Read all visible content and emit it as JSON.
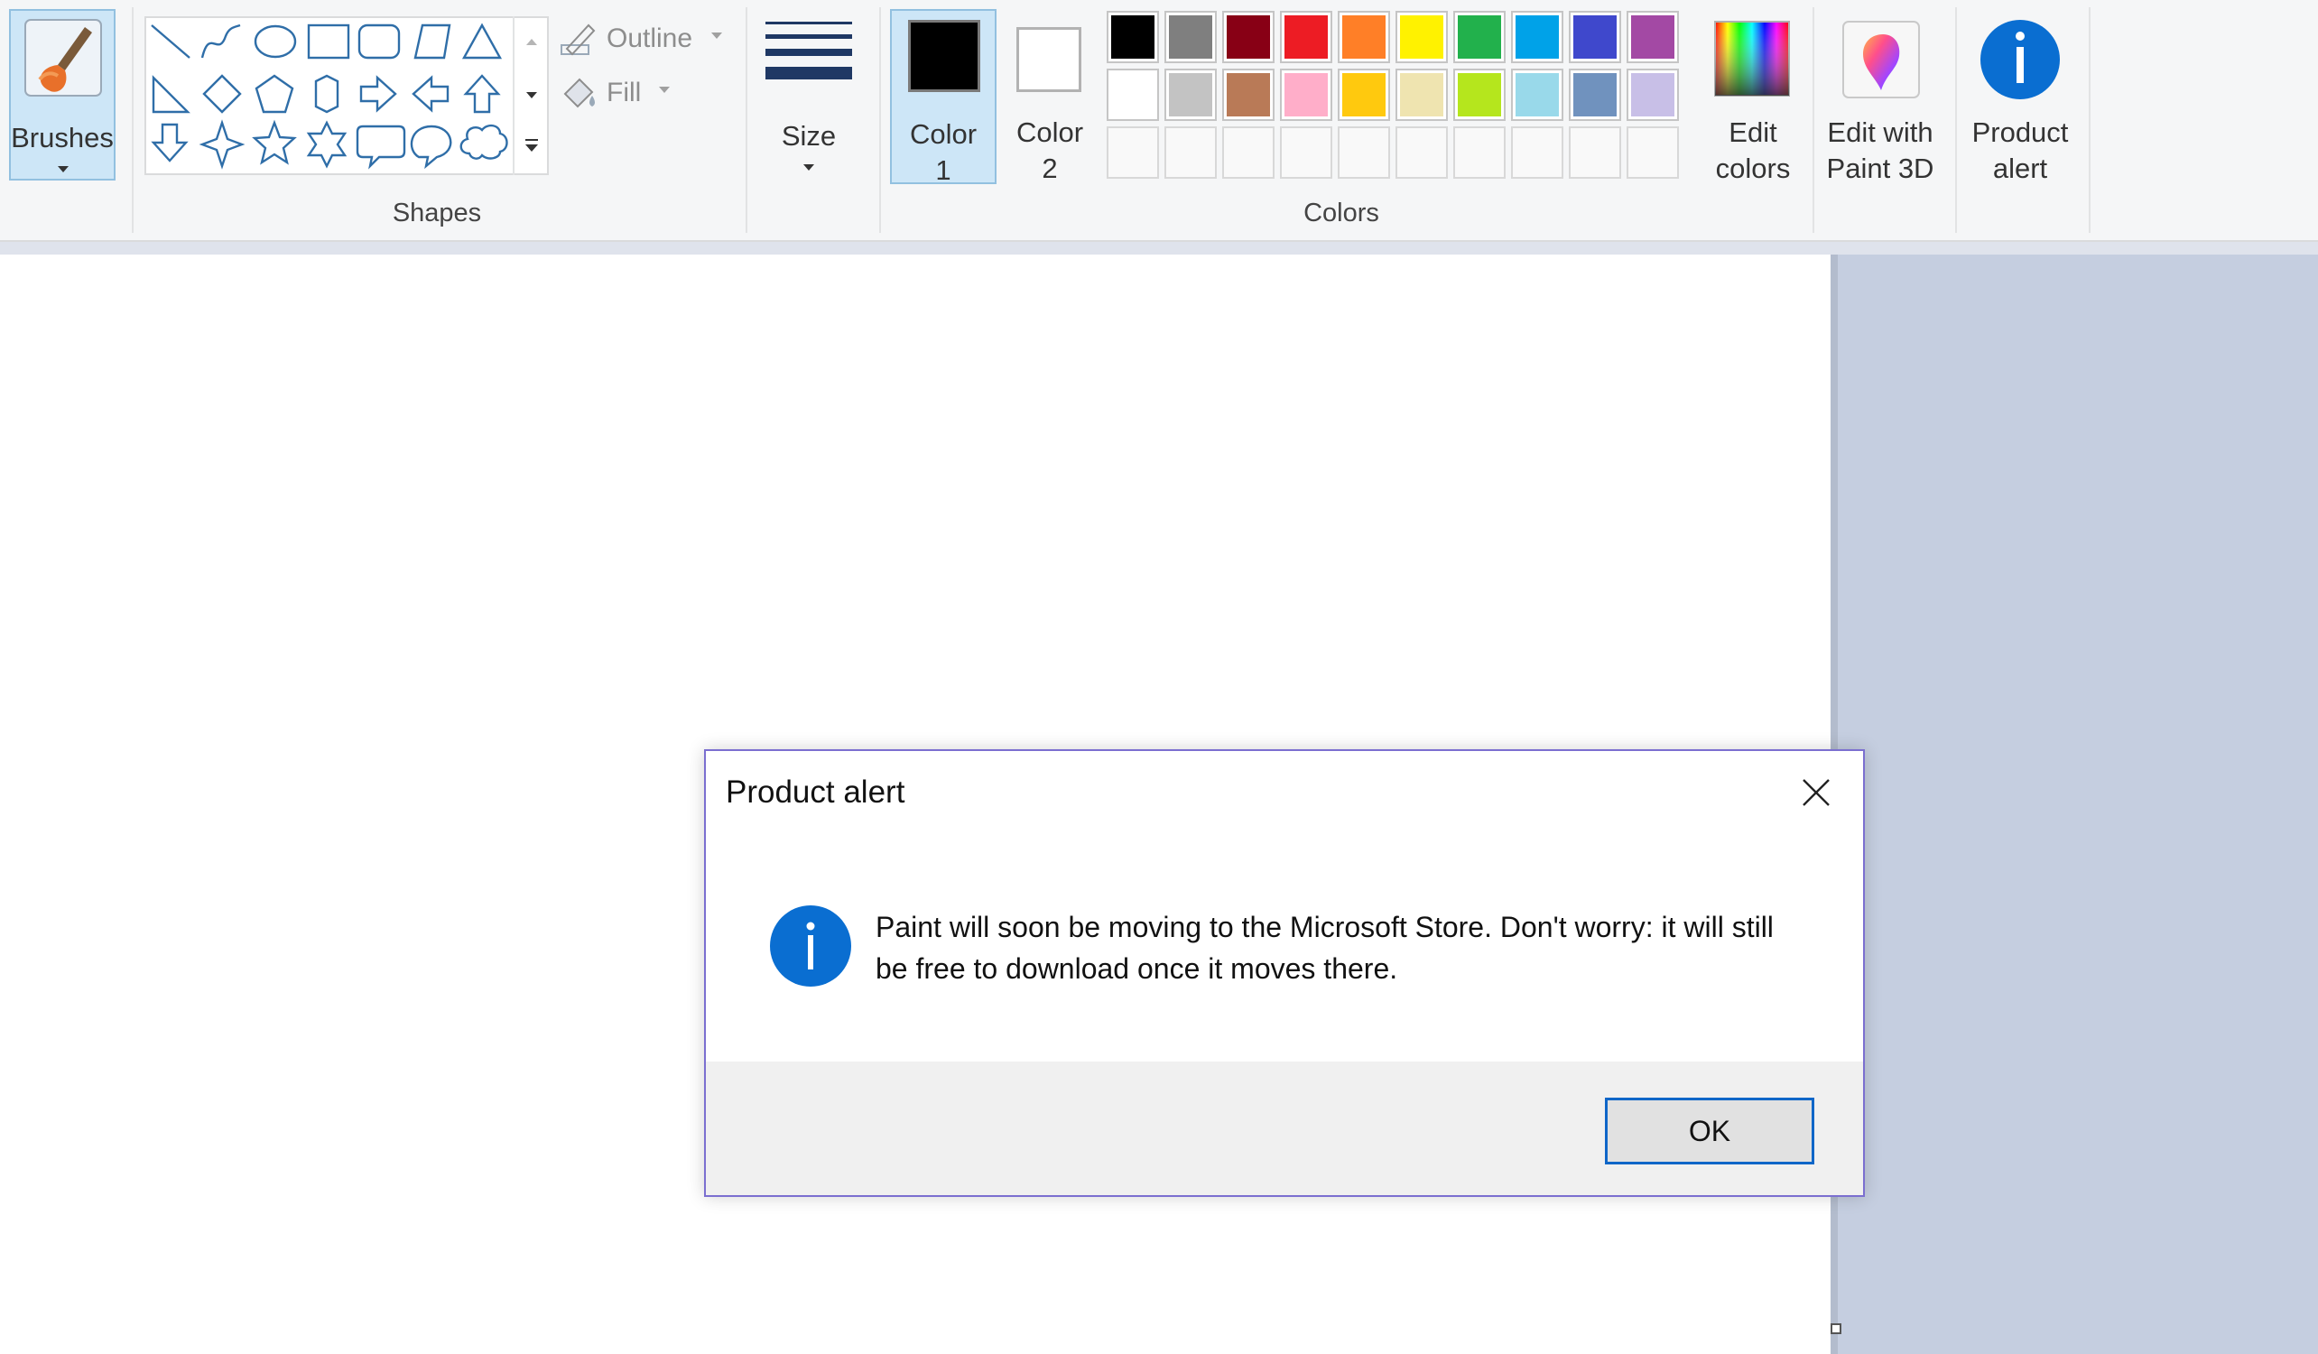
{
  "ribbon": {
    "brushes_label": "Brushes",
    "shapes_group_label": "Shapes",
    "outline_label": "Outline",
    "fill_label": "Fill",
    "size_label": "Size",
    "color1_label_line1": "Color",
    "color1_label_line2": "1",
    "color2_label_line1": "Color",
    "color2_label_line2": "2",
    "colors_group_label": "Colors",
    "edit_colors_line1": "Edit",
    "edit_colors_line2": "colors",
    "paint3d_line1": "Edit with",
    "paint3d_line2": "Paint 3D",
    "product_alert_line1": "Product",
    "product_alert_line2": "alert",
    "color1_value": "#000000",
    "color2_value": "#ffffff",
    "palette": [
      [
        "#000000",
        "#7f7f7f",
        "#880015",
        "#ed1c24",
        "#ff7f27",
        "#fff200",
        "#22b14c",
        "#00a2e8",
        "#3f48cc",
        "#a349a4"
      ],
      [
        "#ffffff",
        "#c3c3c3",
        "#b97a57",
        "#ffaec9",
        "#ffc90e",
        "#efe4b0",
        "#b5e61d",
        "#99d9ea",
        "#7092be",
        "#c8bfe7"
      ],
      [
        "",
        "",
        "",
        "",
        "",
        "",
        "",
        "",
        "",
        ""
      ]
    ],
    "shapes": [
      [
        "line-icon",
        "curve-icon",
        "oval-icon",
        "rectangle-icon",
        "rounded-rectangle-icon",
        "trapezoid-icon",
        "triangle-icon"
      ],
      [
        "right-triangle-icon",
        "diamond-icon",
        "pentagon-icon",
        "hexagon-icon",
        "right-arrow-icon",
        "left-arrow-icon",
        "up-arrow-icon"
      ],
      [
        "down-arrow-icon",
        "four-point-star-icon",
        "five-point-star-icon",
        "six-point-star-icon",
        "rounded-callout-icon",
        "oval-callout-icon",
        "cloud-callout-icon"
      ]
    ]
  },
  "dialog": {
    "title": "Product alert",
    "message": "Paint will soon be moving to the Microsoft Store. Don't worry: it will still be free to download once it moves there.",
    "ok_label": "OK"
  }
}
